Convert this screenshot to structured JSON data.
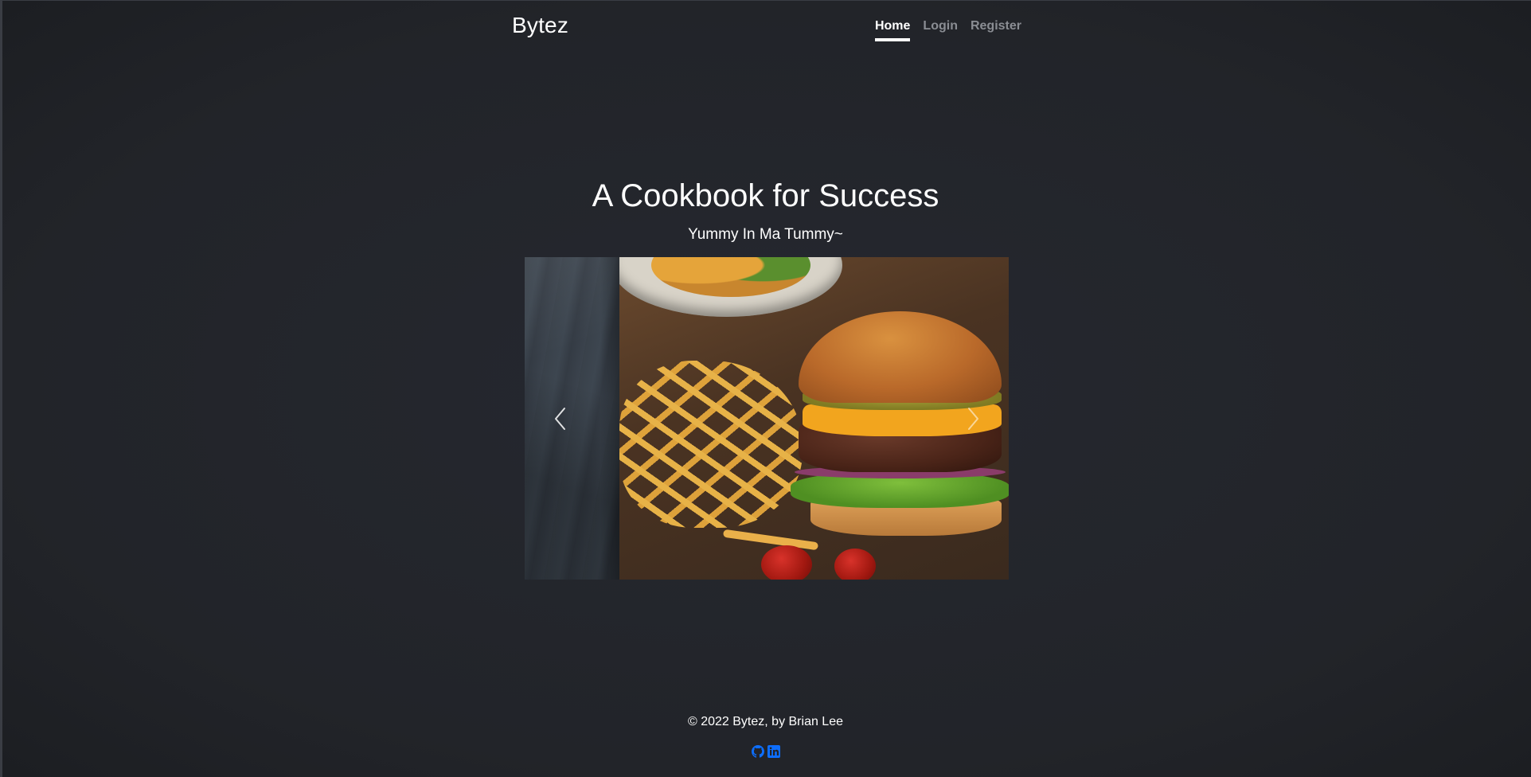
{
  "navbar": {
    "brand": "Bytez",
    "links": [
      {
        "label": "Home",
        "active": true
      },
      {
        "label": "Login",
        "active": false
      },
      {
        "label": "Register",
        "active": false
      }
    ]
  },
  "hero": {
    "title": "A Cookbook for Success",
    "subtitle": "Yummy In Ma Tummy~"
  },
  "carousel": {
    "prev_icon": "chevron-left-icon",
    "next_icon": "chevron-right-icon"
  },
  "footer": {
    "copyright": "© 2022 Bytez, by Brian Lee",
    "social_icons": [
      "github-icon",
      "linkedin-icon"
    ],
    "icon_color": "#0d6efd"
  },
  "colors": {
    "background": "#212328",
    "active_link": "#ffffff",
    "inactive_link": "#8a8d93"
  }
}
